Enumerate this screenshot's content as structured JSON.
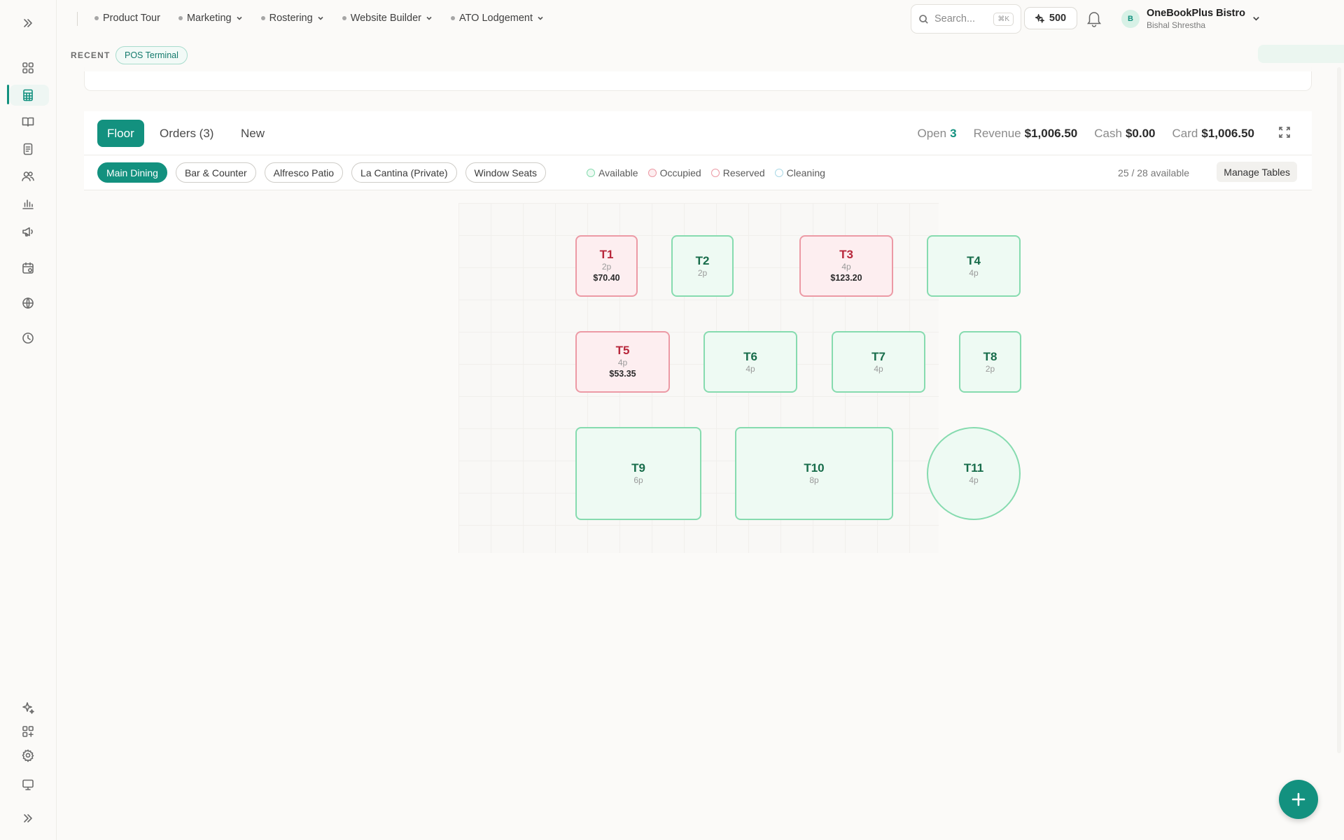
{
  "top_nav": {
    "items": [
      {
        "label": "Product Tour",
        "has_menu": false
      },
      {
        "label": "Marketing",
        "has_menu": true
      },
      {
        "label": "Rostering",
        "has_menu": true
      },
      {
        "label": "Website Builder",
        "has_menu": true
      },
      {
        "label": "ATO Lodgement",
        "has_menu": true
      }
    ],
    "search": {
      "placeholder": "Search...",
      "shortcut": "⌘K"
    },
    "credits": "500",
    "org": {
      "initial": "B",
      "name": "OneBookPlus Bistro",
      "user": "Bishal Shrestha"
    }
  },
  "recent": {
    "label": "RECENT",
    "chip": "POS Terminal"
  },
  "pos": {
    "tabs": [
      "Floor",
      "Orders (3)",
      "New"
    ],
    "active_tab": "Floor",
    "stats": [
      {
        "label": "Open",
        "value": "3"
      },
      {
        "label": "Revenue",
        "value": "$1,006.50"
      },
      {
        "label": "Cash",
        "value": "$0.00"
      },
      {
        "label": "Card",
        "value": "$1,006.50"
      }
    ],
    "areas": [
      "Main Dining",
      "Bar & Counter",
      "Alfresco Patio",
      "La Cantina (Private)",
      "Window Seats"
    ],
    "active_area": "Main Dining",
    "legend": [
      {
        "label": "Available",
        "border": "#86dbaf",
        "fill": "#eefaf3"
      },
      {
        "label": "Occupied",
        "border": "#ec9aa5",
        "fill": "#fdeef0"
      },
      {
        "label": "Reserved",
        "border": "#ec9aa5",
        "fill": "#fff"
      },
      {
        "label": "Cleaning",
        "border": "#a9d8e6",
        "fill": "#fff"
      }
    ],
    "available_count": "25 / 28 available",
    "manage_label": "Manage Tables",
    "tables": [
      {
        "name": "T1",
        "capacity": "2p",
        "status": "occupied",
        "amount": "$70.40"
      },
      {
        "name": "T2",
        "capacity": "2p",
        "status": "available",
        "amount": ""
      },
      {
        "name": "T3",
        "capacity": "4p",
        "status": "occupied",
        "amount": "$123.20"
      },
      {
        "name": "T4",
        "capacity": "4p",
        "status": "available",
        "amount": ""
      },
      {
        "name": "T5",
        "capacity": "4p",
        "status": "occupied",
        "amount": "$53.35"
      },
      {
        "name": "T6",
        "capacity": "4p",
        "status": "available",
        "amount": ""
      },
      {
        "name": "T7",
        "capacity": "4p",
        "status": "available",
        "amount": ""
      },
      {
        "name": "T8",
        "capacity": "2p",
        "status": "available",
        "amount": ""
      },
      {
        "name": "T9",
        "capacity": "6p",
        "status": "available",
        "amount": ""
      },
      {
        "name": "T10",
        "capacity": "8p",
        "status": "available",
        "amount": ""
      },
      {
        "name": "T11",
        "capacity": "4p",
        "status": "available",
        "amount": ""
      }
    ]
  },
  "colors": {
    "accent": "#13917f",
    "available": "#86dbaf",
    "occupied": "#ec9aa5"
  },
  "sidebar": {
    "icons": [
      "collapse-icon",
      "dashboard-icon",
      "pos-icon",
      "books-icon",
      "invoice-icon",
      "contacts-icon",
      "reports-icon",
      "marketing-icon",
      "calendar-icon",
      "website-icon",
      "history-icon",
      "ai-sparkle-icon",
      "apps-icon",
      "settings-icon",
      "monitor-icon",
      "expand-icon"
    ],
    "active": "pos-icon"
  }
}
